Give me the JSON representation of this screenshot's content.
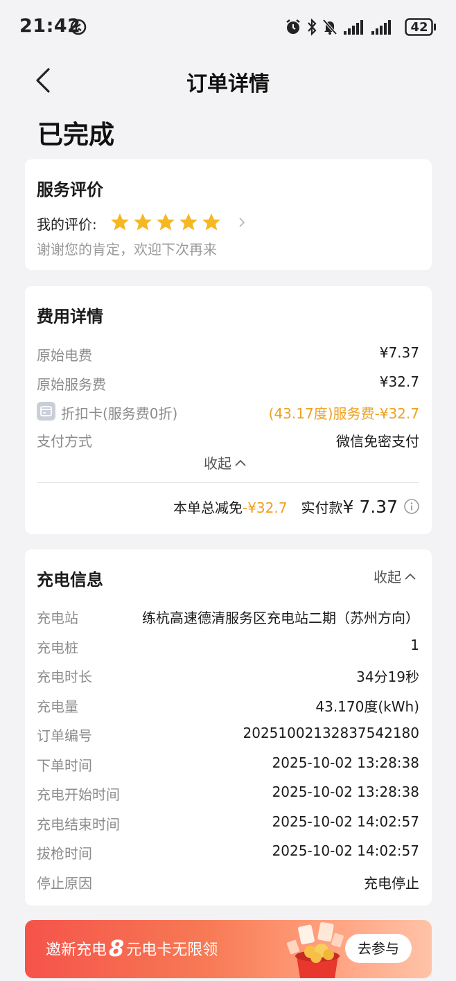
{
  "status_bar": {
    "time": "21:42",
    "battery": "42"
  },
  "header": {
    "title": "订单详情"
  },
  "order_status": "已完成",
  "rating_card": {
    "title": "服务评价",
    "my_rating_label": "我的评价:",
    "stars": 5,
    "thanks": "谢谢您的肯定，欢迎下次再来"
  },
  "fees_card": {
    "title": "费用详情",
    "rows": [
      {
        "label": "原始电费",
        "value": "¥7.37"
      },
      {
        "label": "原始服务费",
        "value": "¥32.7"
      },
      {
        "label": "折扣卡(服务费0折)",
        "value": "(43.17度)服务费-¥32.7"
      },
      {
        "label": "支付方式",
        "value": "微信免密支付"
      }
    ],
    "collapse": "收起",
    "total_discount_label": "本单总减免",
    "total_discount_value": "-¥32.7",
    "paid_label": "实付款",
    "paid_value": "¥ 7.37"
  },
  "charge_card": {
    "title": "充电信息",
    "collapse": "收起",
    "rows": [
      {
        "label": "充电站",
        "value": "练杭高速德清服务区充电站二期（苏州方向）"
      },
      {
        "label": "充电桩",
        "value": "1"
      },
      {
        "label": "充电时长",
        "value": "34分19秒"
      },
      {
        "label": "充电量",
        "value": "43.170度(kWh)"
      },
      {
        "label": "订单编号",
        "value": "20251002132837542180"
      },
      {
        "label": "下单时间",
        "value": "2025-10-02 13:28:38"
      },
      {
        "label": "充电开始时间",
        "value": "2025-10-02 13:28:38"
      },
      {
        "label": "充电结束时间",
        "value": "2025-10-02 14:02:57"
      },
      {
        "label": "拔枪时间",
        "value": "2025-10-02 14:02:57"
      },
      {
        "label": "停止原因",
        "value": "充电停止"
      }
    ]
  },
  "banner": {
    "text_prefix": "邀新充电",
    "amount": "8",
    "text_suffix": "元电卡无限领",
    "button": "去参与"
  },
  "colors": {
    "accent_orange": "#f0a020",
    "star": "#f5b824",
    "banner_red": "#f5534a"
  }
}
